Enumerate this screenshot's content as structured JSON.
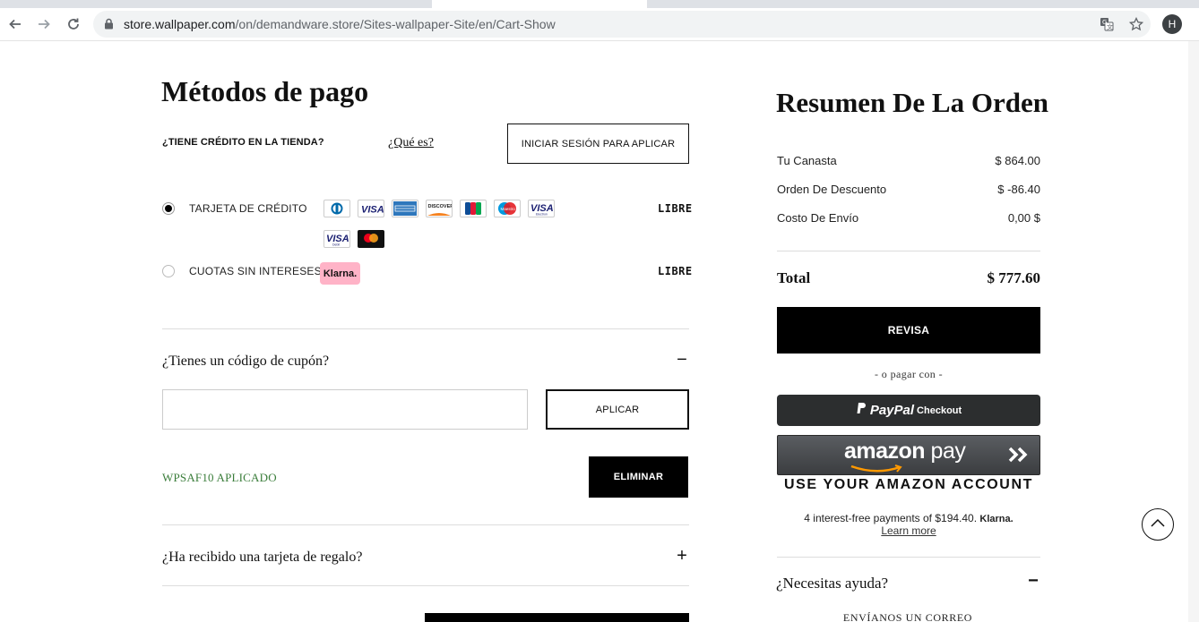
{
  "browser": {
    "url_host": "store.wallpaper.com",
    "url_path": "/on/demandware.store/Sites-wallpaper-Site/en/Cart-Show",
    "profile_initial": "H"
  },
  "payment": {
    "title": "Métodos de pago",
    "store_credit_question": "¿TIENE CRÉDITO EN LA TIENDA?",
    "what_is_link": "¿Qué es?",
    "login_apply_button": "INICIAR SESIÓN PARA APLICAR",
    "methods": [
      {
        "label": "TARJETA DE CRÉDITO",
        "price": "LIBRE",
        "selected": true
      },
      {
        "label": "CUOTAS SIN INTERESES",
        "price": "LIBRE",
        "selected": false
      }
    ],
    "cards": [
      "diners",
      "visa",
      "amex",
      "discover",
      "jcb",
      "maestro",
      "visa-electron",
      "visa-debit",
      "mastercard"
    ],
    "klarna_badge": "Klarna."
  },
  "coupon": {
    "title": "¿Tienes un código de cupón?",
    "toggle": "−",
    "input_value": "",
    "apply_button": "APLICAR",
    "applied_text": "WPSAF10 APLICADO",
    "remove_button": "ELIMINAR"
  },
  "gift": {
    "title": "¿Ha recibido una tarjeta de regalo?",
    "toggle": "+"
  },
  "summary": {
    "title": "Resumen De La Orden",
    "rows": [
      {
        "label": "Tu Canasta",
        "value": "$ 864.00"
      },
      {
        "label": "Orden De Descuento",
        "value": "$ -86.40"
      },
      {
        "label": "Costo De Envío",
        "value": "0,00 $"
      }
    ],
    "total_label": "Total",
    "total_value": "$ 777.60",
    "checkout_button": "REVISA",
    "or_pay_with": "- o pagar con -",
    "paypal_brand": "PayPal",
    "paypal_checkout": "Checkout",
    "amazon_brand": "amazon",
    "amazon_pay": "pay",
    "amazon_account": "USE YOUR AMAZON ACCOUNT",
    "klarna_note": "4 interest-free payments of $194.40.",
    "klarna_brand": "Klarna.",
    "learn_more": "Learn more",
    "help_title": "¿Necesitas ayuda?",
    "help_toggle": "−",
    "email_us": "ENVÍANOS UN CORREO"
  },
  "colors": {
    "applied_green": "#3a7d3a",
    "klarna_pink": "#ffb3c7",
    "paypal_dark": "#2c2e2f",
    "amazon_gray": "#4a4d51",
    "amazon_orange": "#ff9900"
  }
}
